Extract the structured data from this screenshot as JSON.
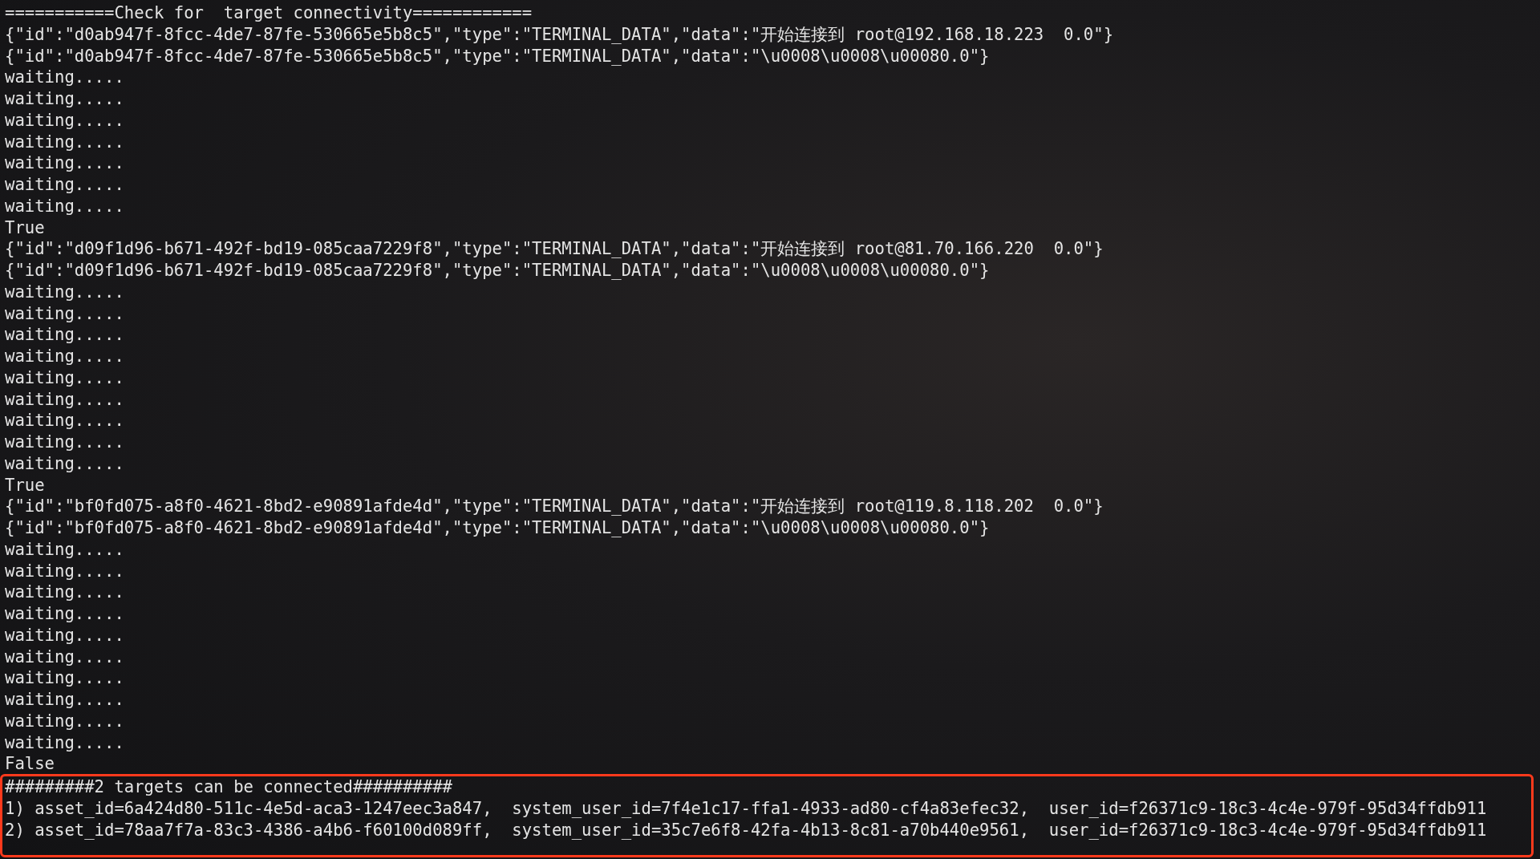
{
  "terminal": {
    "lines": [
      "===========Check for  target connectivity============",
      "{\"id\":\"d0ab947f-8fcc-4de7-87fe-530665e5b8c5\",\"type\":\"TERMINAL_DATA\",\"data\":\"开始连接到 root@192.168.18.223  0.0\"}",
      "{\"id\":\"d0ab947f-8fcc-4de7-87fe-530665e5b8c5\",\"type\":\"TERMINAL_DATA\",\"data\":\"\\u0008\\u0008\\u00080.0\"}",
      "waiting.....",
      "waiting.....",
      "waiting.....",
      "waiting.....",
      "waiting.....",
      "waiting.....",
      "waiting.....",
      "True",
      "{\"id\":\"d09f1d96-b671-492f-bd19-085caa7229f8\",\"type\":\"TERMINAL_DATA\",\"data\":\"开始连接到 root@81.70.166.220  0.0\"}",
      "{\"id\":\"d09f1d96-b671-492f-bd19-085caa7229f8\",\"type\":\"TERMINAL_DATA\",\"data\":\"\\u0008\\u0008\\u00080.0\"}",
      "waiting.....",
      "waiting.....",
      "waiting.....",
      "waiting.....",
      "waiting.....",
      "waiting.....",
      "waiting.....",
      "waiting.....",
      "waiting.....",
      "True",
      "{\"id\":\"bf0fd075-a8f0-4621-8bd2-e90891afde4d\",\"type\":\"TERMINAL_DATA\",\"data\":\"开始连接到 root@119.8.118.202  0.0\"}",
      "{\"id\":\"bf0fd075-a8f0-4621-8bd2-e90891afde4d\",\"type\":\"TERMINAL_DATA\",\"data\":\"\\u0008\\u0008\\u00080.0\"}",
      "waiting.....",
      "waiting.....",
      "waiting.....",
      "waiting.....",
      "waiting.....",
      "waiting.....",
      "waiting.....",
      "waiting.....",
      "waiting.....",
      "waiting.....",
      "False"
    ],
    "highlight": {
      "lines": [
        "#########2 targets can be connected##########",
        "1) asset_id=6a424d80-511c-4e5d-aca3-1247eec3a847,  system_user_id=7f4e1c17-ffa1-4933-ad80-cf4a83efec32,  user_id=f26371c9-18c3-4c4e-979f-95d34ffdb911",
        "2) asset_id=78aa7f7a-83c3-4386-a4b6-f60100d089ff,  system_user_id=35c7e6f8-42fa-4b13-8c81-a70b440e9561,  user_id=f26371c9-18c3-4c4e-979f-95d34ffdb911"
      ]
    }
  }
}
